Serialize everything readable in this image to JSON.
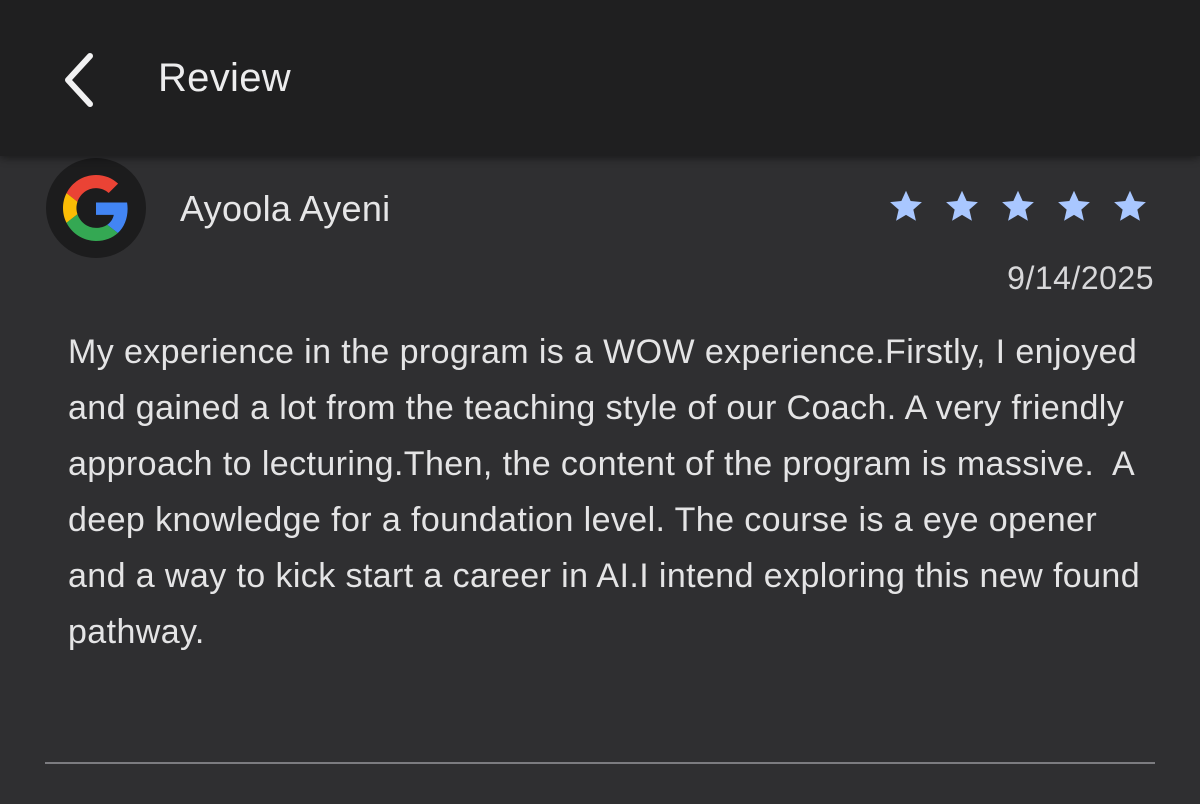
{
  "app_bar": {
    "title": "Review",
    "back_icon": "chevron-left-icon"
  },
  "review": {
    "source_icon": "google-logo",
    "reviewer_name": "Ayoola Ayeni",
    "rating": 5,
    "rating_max": 5,
    "star_color": "#a9c7ff",
    "date": "9/14/2025",
    "text": "My experience in the program is a WOW experience.Firstly, I enjoyed and gained a lot from the teaching style of our Coach. A very friendly approach to lecturing.Then, the content of the program is massive.  A deep knowledge for a foundation level. The course is a eye opener and a way to kick start a career in AI.I intend exploring this new found pathway."
  }
}
